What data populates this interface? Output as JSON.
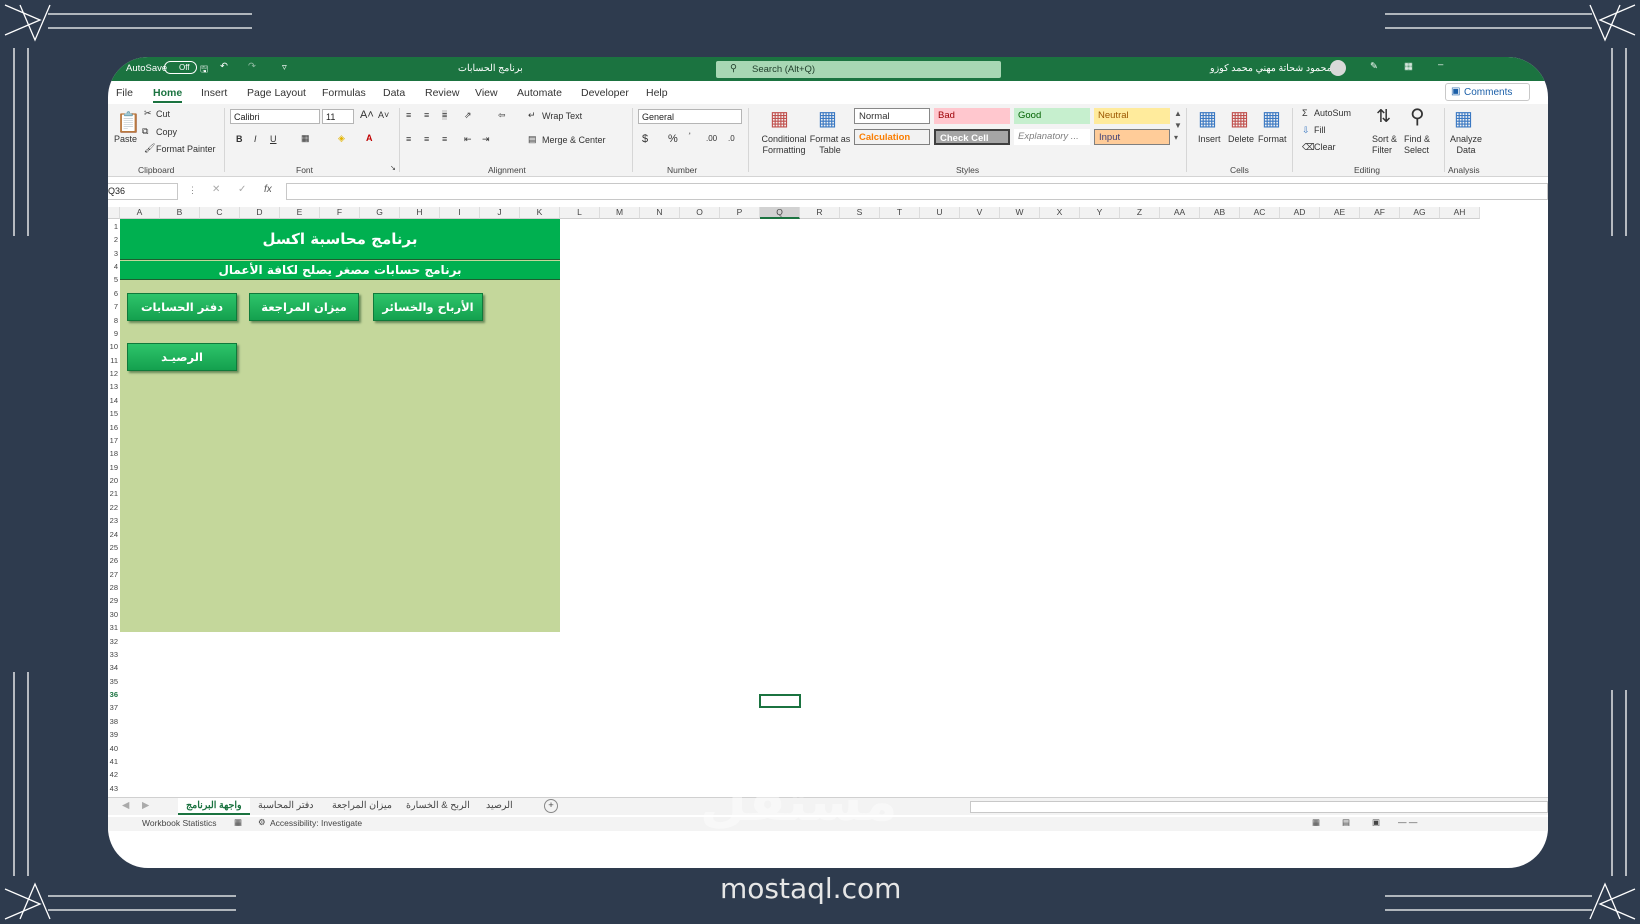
{
  "titlebar": {
    "autosave": "AutoSave",
    "autosave_state": "Off",
    "filename": "برنامج الحسابات",
    "search_placeholder": "Search (Alt+Q)",
    "user": "محمود شحاتة مهني محمد كوزو"
  },
  "tabs": [
    "File",
    "Home",
    "Insert",
    "Page Layout",
    "Formulas",
    "Data",
    "Review",
    "View",
    "Automate",
    "Developer",
    "Help"
  ],
  "comments_label": "Comments",
  "ribbon": {
    "clipboard": {
      "paste": "Paste",
      "cut": "Cut",
      "copy": "Copy",
      "format_painter": "Format Painter",
      "label": "Clipboard"
    },
    "font": {
      "name": "Calibri",
      "size": "11",
      "label": "Font"
    },
    "alignment": {
      "wrap": "Wrap Text",
      "merge": "Merge & Center",
      "label": "Alignment"
    },
    "number": {
      "format": "General",
      "label": "Number"
    },
    "styles": {
      "conditional": "Conditional Formatting",
      "format_table": "Format as Table",
      "normal": "Normal",
      "bad": "Bad",
      "good": "Good",
      "neutral": "Neutral",
      "calculation": "Calculation",
      "check_cell": "Check Cell",
      "explanatory": "Explanatory ...",
      "input": "Input",
      "label": "Styles"
    },
    "cells": {
      "insert": "Insert",
      "delete": "Delete",
      "format": "Format",
      "label": "Cells"
    },
    "editing": {
      "autosum": "AutoSum",
      "fill": "Fill",
      "clear": "Clear",
      "sort": "Sort & Filter",
      "find": "Find & Select",
      "label": "Editing"
    },
    "analysis": {
      "analyze": "Analyze Data",
      "label": "Analysis"
    }
  },
  "formula_bar": {
    "name_box": "Q36",
    "fx": "fx",
    "value": ""
  },
  "columns": [
    "A",
    "B",
    "C",
    "D",
    "E",
    "F",
    "G",
    "H",
    "I",
    "J",
    "K",
    "L",
    "M",
    "N",
    "O",
    "P",
    "Q",
    "R",
    "S",
    "T",
    "U",
    "V",
    "W",
    "X",
    "Y",
    "Z",
    "AA",
    "AB",
    "AC",
    "AD",
    "AE",
    "AF",
    "AG",
    "AH"
  ],
  "rows": [
    "1",
    "2",
    "3",
    "4",
    "5",
    "6",
    "7",
    "8",
    "9",
    "10",
    "11",
    "12",
    "13",
    "14",
    "15",
    "16",
    "17",
    "18",
    "19",
    "20",
    "21",
    "22",
    "23",
    "24",
    "25",
    "26",
    "27",
    "28",
    "29",
    "30",
    "31",
    "32",
    "33",
    "34",
    "35",
    "36",
    "37",
    "38",
    "39",
    "40",
    "41",
    "42",
    "43"
  ],
  "sheet": {
    "title": "برنامج محاسبة اكسل",
    "subtitle": "برنامج حسابات مصغر يصلح لكافة الأعمال",
    "buttons": {
      "ledger": "دفتر الحسابات",
      "trial_balance": "ميزان المراجعة",
      "profit_loss": "الأرباح والخسائر",
      "balance": "الرصيـد"
    }
  },
  "sheet_tabs": [
    "واجهة البرنامج",
    "دفتر المحاسبة",
    "ميزان المراجعة",
    "الربح & الخسارة",
    "الرصيد"
  ],
  "status": {
    "workbook_stats": "Workbook Statistics",
    "accessibility": "Accessibility: Investigate"
  },
  "watermark": {
    "logo": "مستقل",
    "url": "mostaql.com"
  },
  "colors": {
    "excel_green": "#1b7340",
    "band_green": "#00b050",
    "panel_green": "#c4d79b",
    "frame": "#2e3b4e"
  }
}
